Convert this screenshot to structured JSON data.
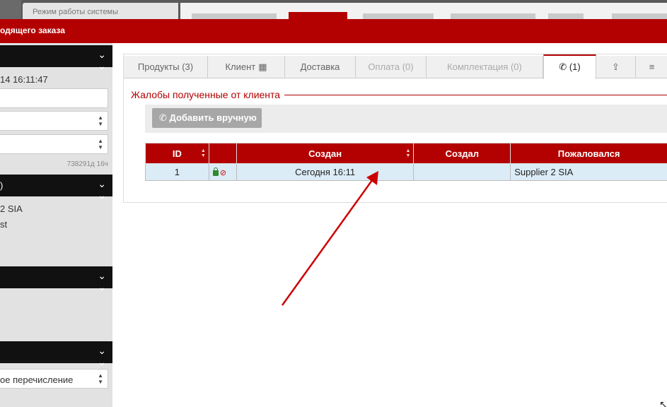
{
  "topbar": {
    "mode_label": "Режим работы системы"
  },
  "header": {
    "title": "одящего заказа"
  },
  "left": {
    "datetime": "14 16:11:47",
    "small_text": "738291д 16ч",
    "sec2_label": ")",
    "supplier": "2 SIA",
    "st": "st",
    "payment_select": "ое перечисление"
  },
  "tabs": [
    {
      "label": "Продукты (3)"
    },
    {
      "label": "Клиент"
    },
    {
      "label": "Доставка"
    },
    {
      "label": "Оплата (0)"
    },
    {
      "label": "Комплектация (0)"
    },
    {
      "label": "(1)"
    }
  ],
  "complaints": {
    "legend": "Жалобы полученные от клиента",
    "add_button": "Добавить вручную",
    "columns": {
      "id": "ID",
      "created": "Создан",
      "creator": "Создал",
      "complainer": "Пожаловался"
    },
    "rows": [
      {
        "id": "1",
        "created": "Сегодня 16:11",
        "creator": "",
        "complainer": "Supplier 2 SIA"
      }
    ]
  },
  "icons": {
    "phone": "phone-icon",
    "upload": "upload-icon",
    "menu": "hamburger-icon",
    "building": "building-icon",
    "lock": "lock-icon",
    "hidden": "eye-slash-icon"
  },
  "colors": {
    "accent": "#b30000",
    "row_bg": "#dcecf7"
  }
}
